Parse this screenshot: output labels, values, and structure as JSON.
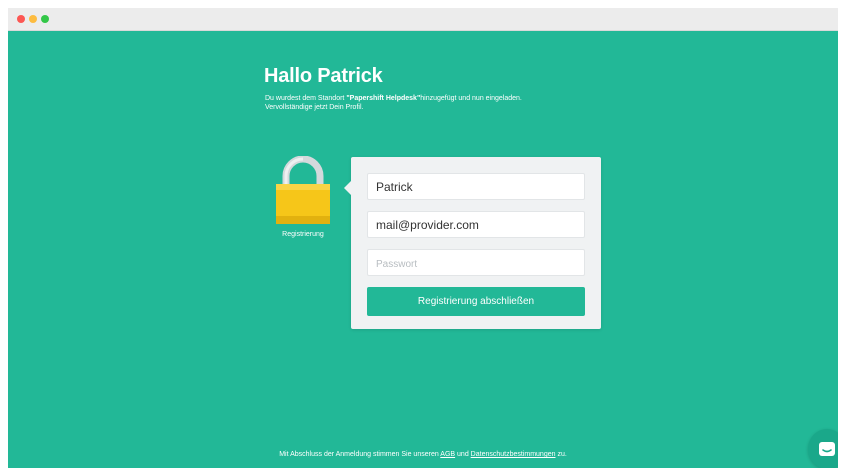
{
  "header": {
    "title": "Hallo Patrick",
    "intro_prefix": "Du wurdest dem Standort ",
    "intro_location": "\"Papershift Helpdesk\"",
    "intro_suffix": "hinzugefügt und nun eingeladen.",
    "intro_line2": "Vervollständige jetzt Dein Profil."
  },
  "lock": {
    "label": "Registrierung",
    "icon": "padlock-icon"
  },
  "form": {
    "name_value": "Patrick",
    "email_value": "mail@provider.com",
    "password_placeholder": "Passwort",
    "submit_label": "Registrierung abschließen"
  },
  "footer": {
    "prefix": "Mit Abschluss der Anmeldung stimmen Sie unseren ",
    "agb_link": "AGB",
    "middle": " und ",
    "privacy_link": "Datenschutzbestimmungen",
    "suffix": " zu."
  },
  "chat": {
    "icon": "chat-icon"
  },
  "colors": {
    "background": "#22b897",
    "button": "#22b897",
    "card": "#f0f2f3",
    "lock_body": "#f6c619",
    "lock_shackle": "#dfe3e6"
  }
}
